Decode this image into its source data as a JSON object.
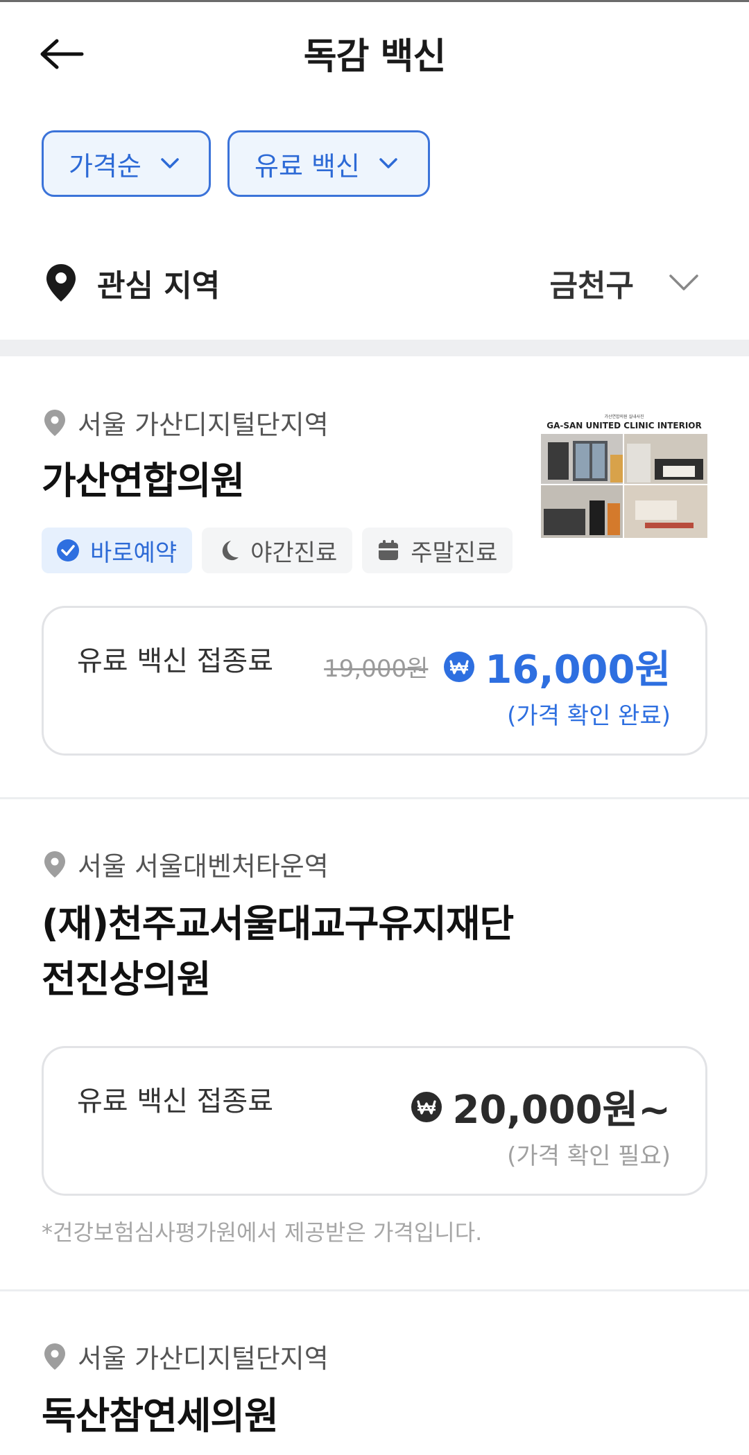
{
  "header": {
    "title": "독감 백신",
    "back_icon": "back-arrow-icon"
  },
  "filters": [
    {
      "label": "가격순",
      "icon": "chevron-down-icon"
    },
    {
      "label": "유료 백신",
      "icon": "chevron-down-icon"
    }
  ],
  "region": {
    "label": "관심 지역",
    "value": "금천구",
    "icon": "location-pin-icon"
  },
  "clinics": [
    {
      "station": "서울 가산디지털단지역",
      "name": "가산연합의원",
      "tags": [
        {
          "label": "바로예약",
          "icon": "check-circle-icon",
          "style": "primary"
        },
        {
          "label": "야간진료",
          "icon": "moon-icon",
          "style": "muted"
        },
        {
          "label": "주말진료",
          "icon": "calendar-icon",
          "style": "muted"
        }
      ],
      "thumbnail": {
        "caption_small": "가산연합의원 실내사진",
        "caption": "GA-SAN UNITED CLINIC  INTERIOR"
      },
      "price": {
        "label": "유료 백신 접종료",
        "original": "19,000원",
        "current": "16,000원",
        "note": "(가격 확인 완료)"
      }
    },
    {
      "station": "서울 서울대벤처타운역",
      "name_line1": "(재)천주교서울대교구유지재단",
      "name_line2": "전진상의원",
      "price": {
        "label": "유료 백신 접종료",
        "current": "20,000원~",
        "note": "(가격 확인 필요)"
      },
      "footnote": "*건강보험심사평가원에서 제공받은 가격입니다."
    },
    {
      "station": "서울 가산디지털단지역",
      "name": "독산참연세의원"
    }
  ],
  "colors": {
    "accent": "#2e6fe0",
    "chip_bg": "#eef5fd",
    "muted_text": "#a0a0a0"
  }
}
